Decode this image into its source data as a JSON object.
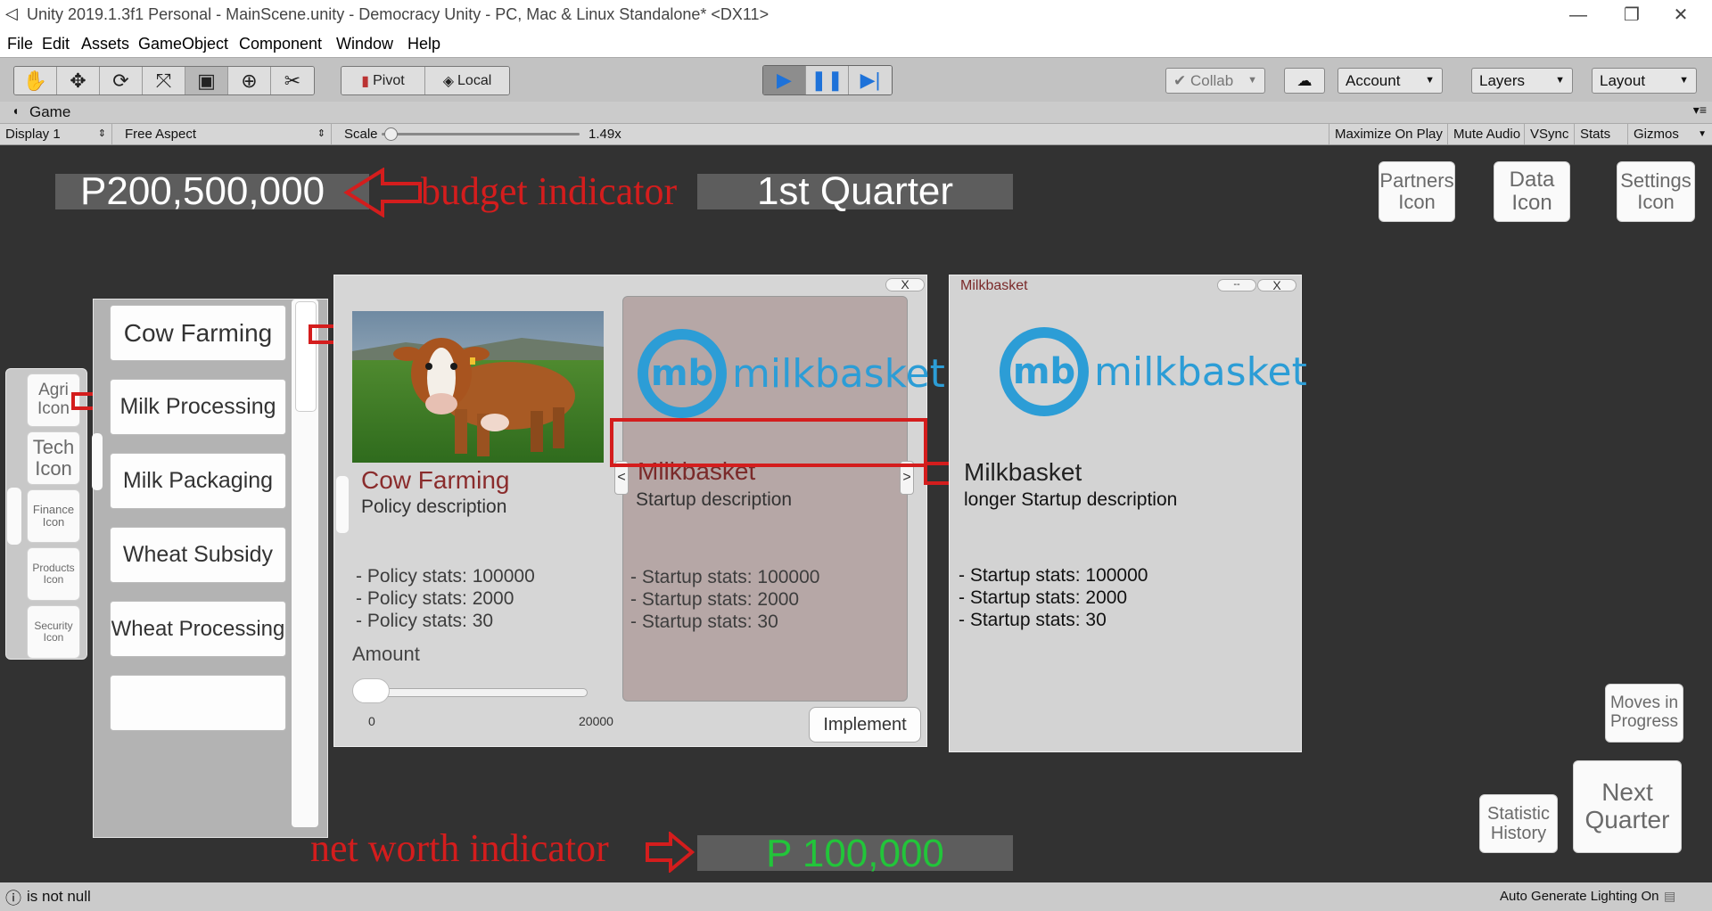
{
  "window": {
    "title": "Unity 2019.1.3f1 Personal - MainScene.unity - Democracy Unity - PC, Mac & Linux Standalone* <DX11>"
  },
  "menu": [
    "File",
    "Edit",
    "Assets",
    "GameObject",
    "Component",
    "Window",
    "Help"
  ],
  "toolbar": {
    "pivot": "Pivot",
    "local": "Local",
    "collab": "Collab",
    "account": "Account",
    "layers": "Layers",
    "layout": "Layout"
  },
  "game_tab": {
    "title": "Game",
    "display": "Display 1",
    "aspect": "Free Aspect",
    "scale_label": "Scale",
    "scale_value": "1.49x",
    "scale_level": 0.05,
    "maximize": "Maximize On Play",
    "mute": "Mute Audio",
    "vsync": "VSync",
    "stats": "Stats",
    "gizmos": "Gizmos"
  },
  "hud": {
    "budget": "P200,500,000",
    "budget_note": "budget indicator",
    "quarter": "1st Quarter",
    "partners": "Partners Icon",
    "data": "Data Icon",
    "settings": "Settings Icon",
    "net_worth": "P 100,000",
    "net_worth_note": "net worth indicator",
    "moves": "Moves in Progress",
    "history": "Statistic History",
    "next": "Next Quarter"
  },
  "categories": [
    "Agri Icon",
    "Tech Icon",
    "Finance Icon",
    "Products Icon",
    "Security Icon"
  ],
  "policies": [
    "Cow Farming",
    "Milk Processing",
    "Milk Packaging",
    "Wheat Subsidy",
    "Wheat Processing"
  ],
  "policy_card": {
    "close": "X",
    "name": "Cow Farming",
    "description": "Policy description",
    "stats": [
      "- Policy stats: 100000",
      "- Policy stats: 2000",
      "- Policy stats: 30"
    ],
    "amount_label": "Amount",
    "amount_min": "0",
    "amount_max": "20000",
    "amount_value": 0
  },
  "startup_card": {
    "logo_mark": "mb",
    "logo_text": "milkbasket",
    "prev": "<",
    "next": ">",
    "name": "Milkbasket",
    "description": "Startup description",
    "stats": [
      "- Startup stats: 100000",
      "- Startup stats: 2000",
      "- Startup stats: 30"
    ],
    "implement": "Implement"
  },
  "detail_window": {
    "title": "Milkbasket",
    "minimize": "--",
    "close": "X",
    "logo_mark": "mb",
    "logo_text": "milkbasket",
    "name": "Milkbasket",
    "description": "longer Startup description",
    "stats": [
      "- Startup stats: 100000",
      "- Startup stats: 2000",
      "- Startup stats: 30"
    ]
  },
  "status": {
    "message": "is not null",
    "right": "Auto Generate Lighting On"
  },
  "colors": {
    "annotation": "#d41d1d",
    "net_worth": "#22c53a",
    "startup_bg": "#b6a7a6",
    "play_blue": "#1e72d9"
  }
}
